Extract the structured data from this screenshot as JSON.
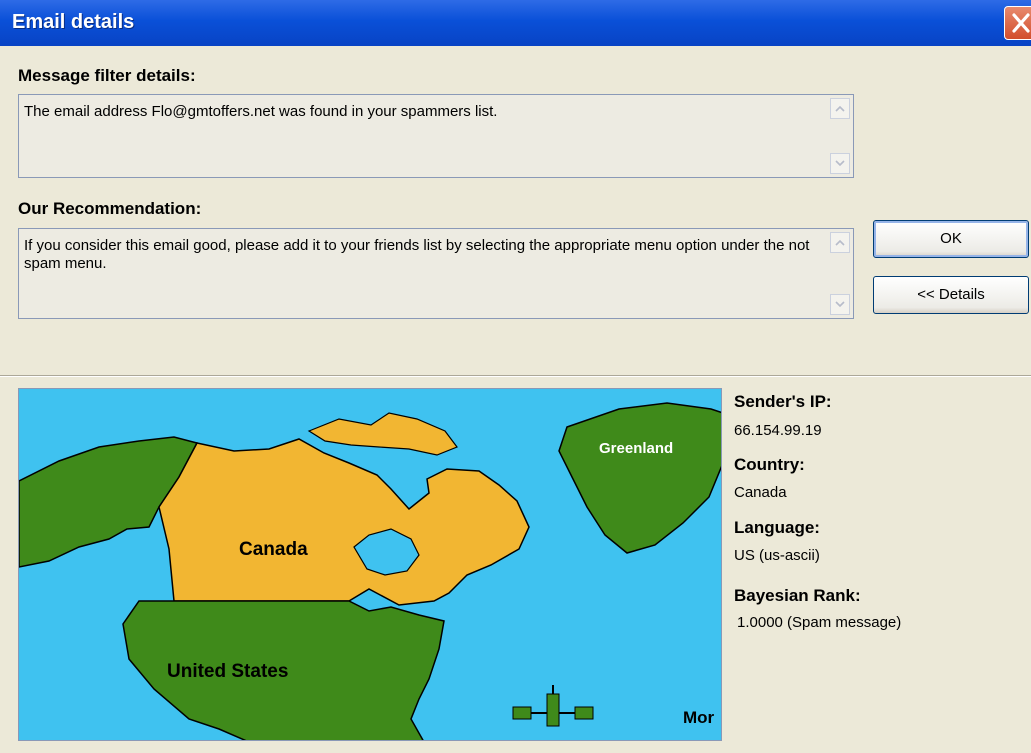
{
  "window": {
    "title": "Email details"
  },
  "filter": {
    "heading": "Message filter details:",
    "text": "The email address Flo@gmtoffers.net was found in your spammers list."
  },
  "recommendation": {
    "heading": "Our Recommendation:",
    "text": "If you consider this email good, please add it to your friends list by selecting the appropriate menu option under the not spam menu."
  },
  "buttons": {
    "ok": "OK",
    "details": "<< Details"
  },
  "map": {
    "labels": {
      "canada": "Canada",
      "united_states": "United States",
      "greenland": "Greenland",
      "more": "Mor"
    },
    "colors": {
      "ocean": "#3FC2F0",
      "highlight": "#F2B632",
      "land": "#3F8A1A"
    }
  },
  "info": {
    "ip_label": "Sender's IP:",
    "ip_value": "66.154.99.19",
    "country_label": "Country:",
    "country_value": "Canada",
    "language_label": "Language:",
    "language_value": "US (us-ascii)",
    "rank_label": "Bayesian Rank:",
    "rank_value": "1.0000 (Spam message)"
  }
}
